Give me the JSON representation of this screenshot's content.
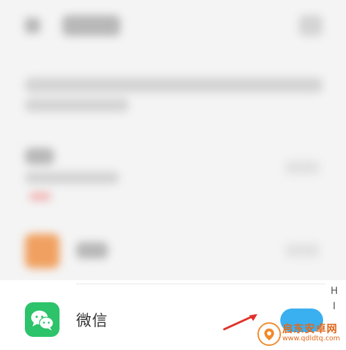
{
  "bottom_row": {
    "app_name": "微信",
    "toggle_on": true
  },
  "alpha_index": [
    "H",
    "I"
  ],
  "watermark": {
    "title": "启东安卓网",
    "url": "www.qdldtq.com"
  },
  "colors": {
    "wechat_green": "#2dc36a",
    "toggle_blue": "#3ab0f0",
    "arrow_red": "#e0322a",
    "watermark_orange": "#e0691d"
  }
}
